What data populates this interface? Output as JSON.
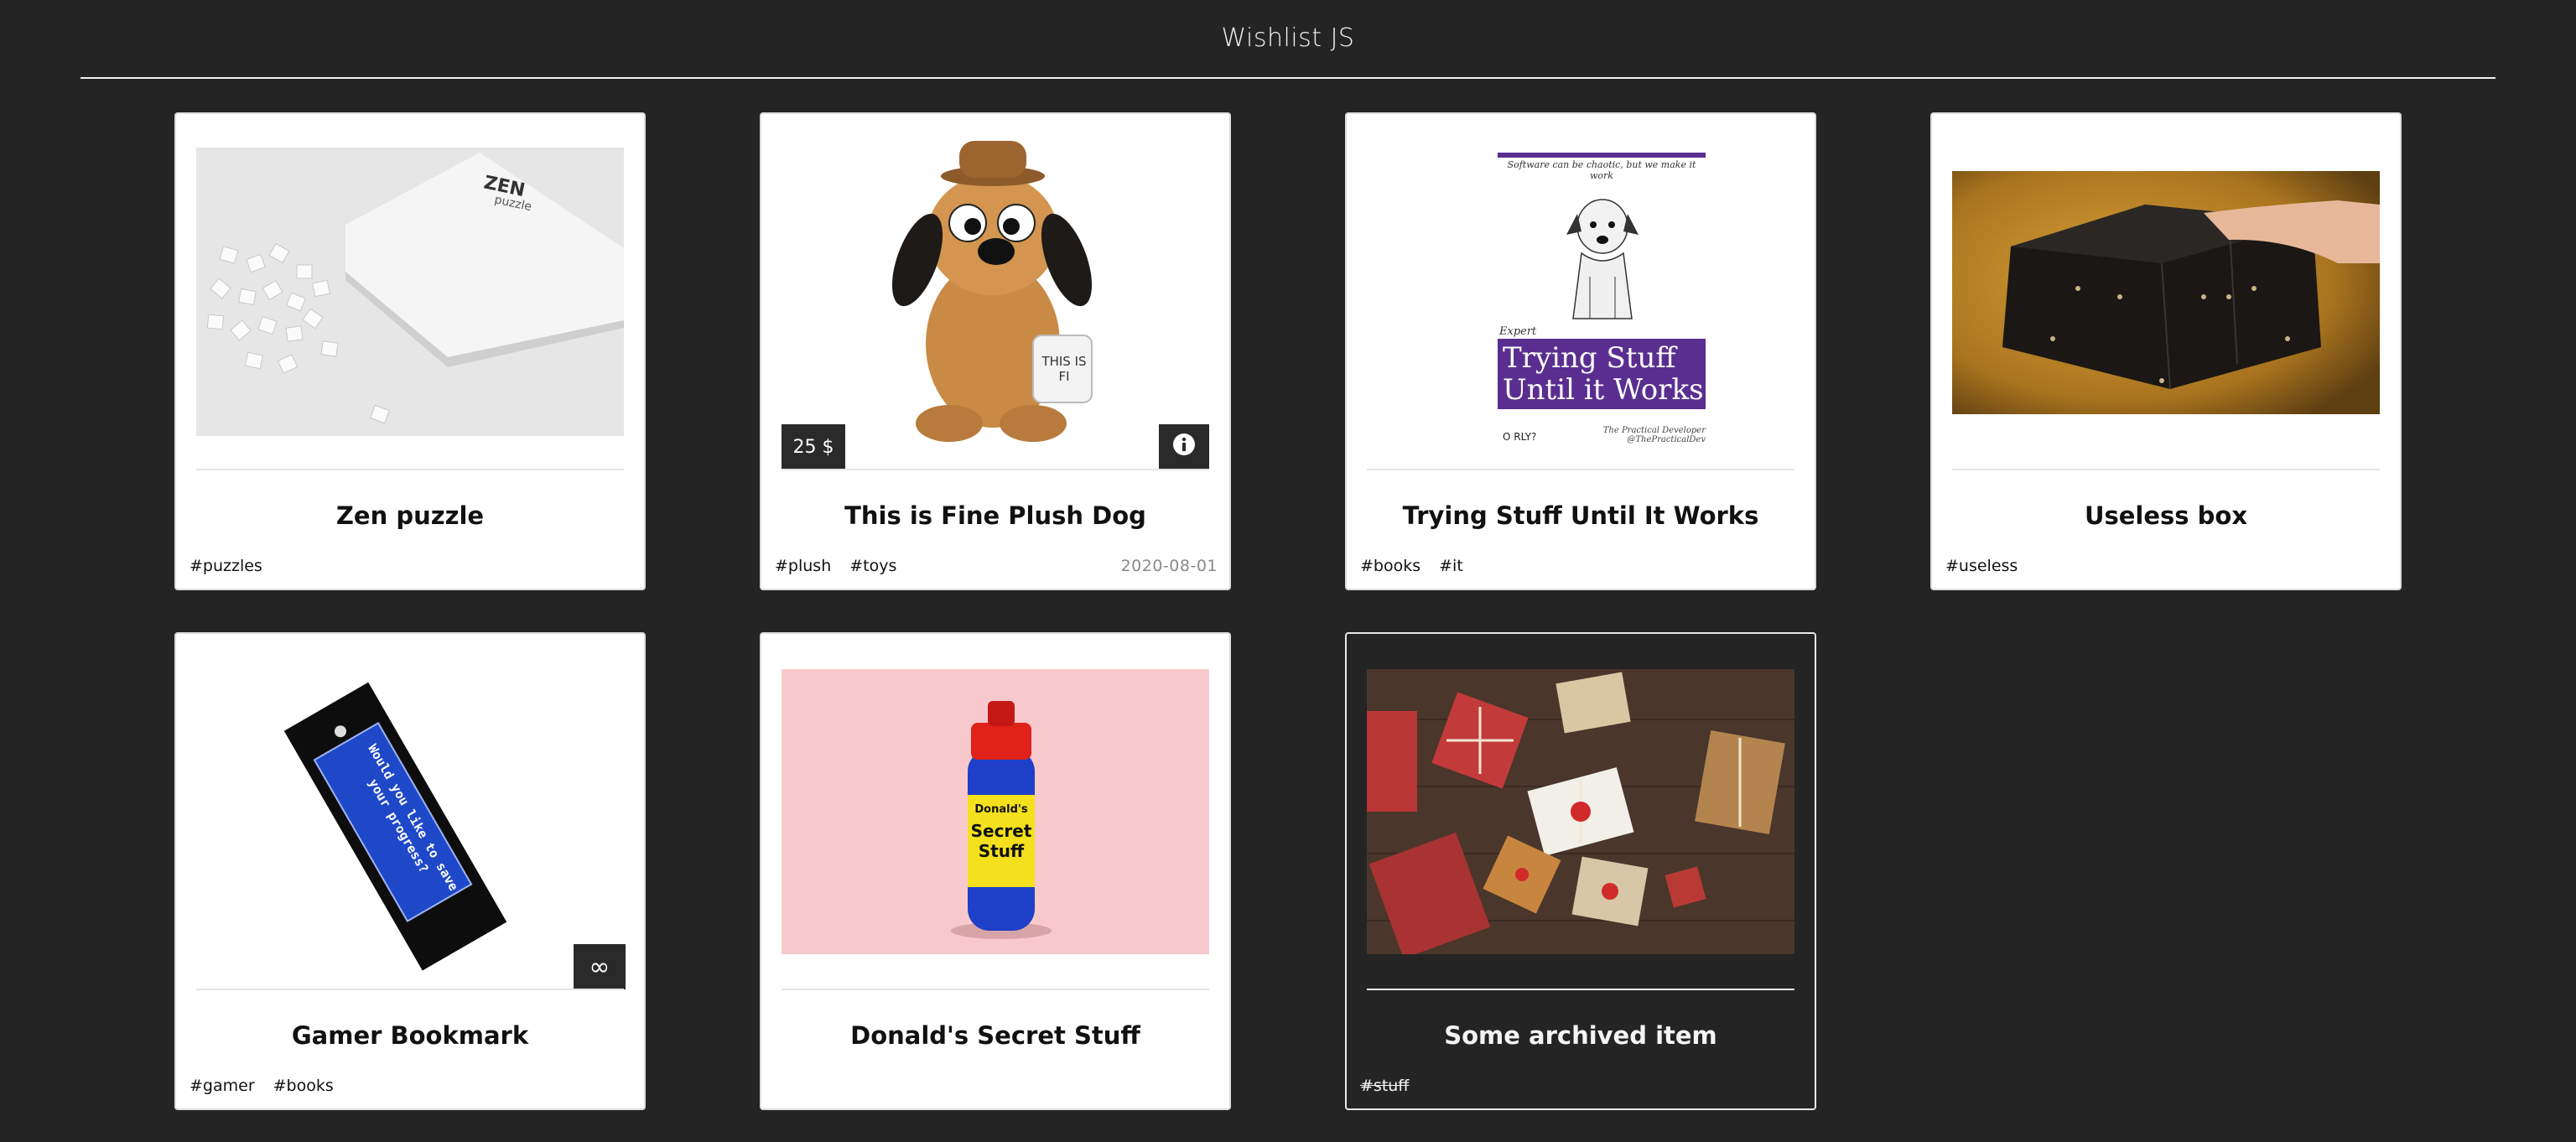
{
  "app": {
    "title": "Wishlist JS"
  },
  "items": [
    {
      "name": "Zen puzzle",
      "tags": [
        "#puzzles"
      ]
    },
    {
      "name": "This is Fine Plush Dog",
      "tags": [
        "#plush",
        "#toys"
      ],
      "price": "25 $",
      "date": "2020-08-01",
      "plush_text": "THIS IS FI"
    },
    {
      "name": "Trying Stuff Until It Works",
      "tags": [
        "#books",
        "#it"
      ],
      "cover": {
        "tagline": "Software can be chaotic, but we make it work",
        "kicker": "Expert",
        "title_line1": "Trying Stuff",
        "title_line2": "Until it Works",
        "publisher": "O RLY?",
        "author_line1": "The Practical Developer",
        "author_line2": "@ThePracticalDev"
      }
    },
    {
      "name": "Useless box",
      "tags": [
        "#useless"
      ]
    },
    {
      "name": "Gamer Bookmark",
      "tags": [
        "#gamer",
        "#books"
      ],
      "bookmark_text": "Would you like to save your progress?"
    },
    {
      "name": "Donald's Secret Stuff",
      "tags": [],
      "bottle_label_top": "Donald's",
      "bottle_label_main": "Secret Stuff"
    },
    {
      "name": "Some archived item",
      "tags": [
        "#stuff"
      ],
      "archived": true
    }
  ],
  "colors": {
    "background": "#232423",
    "card": "#ffffff",
    "badge": "#2a2a2a",
    "book_purple": "#5a2e91"
  },
  "icons": [
    "info-icon",
    "infinity-icon"
  ]
}
